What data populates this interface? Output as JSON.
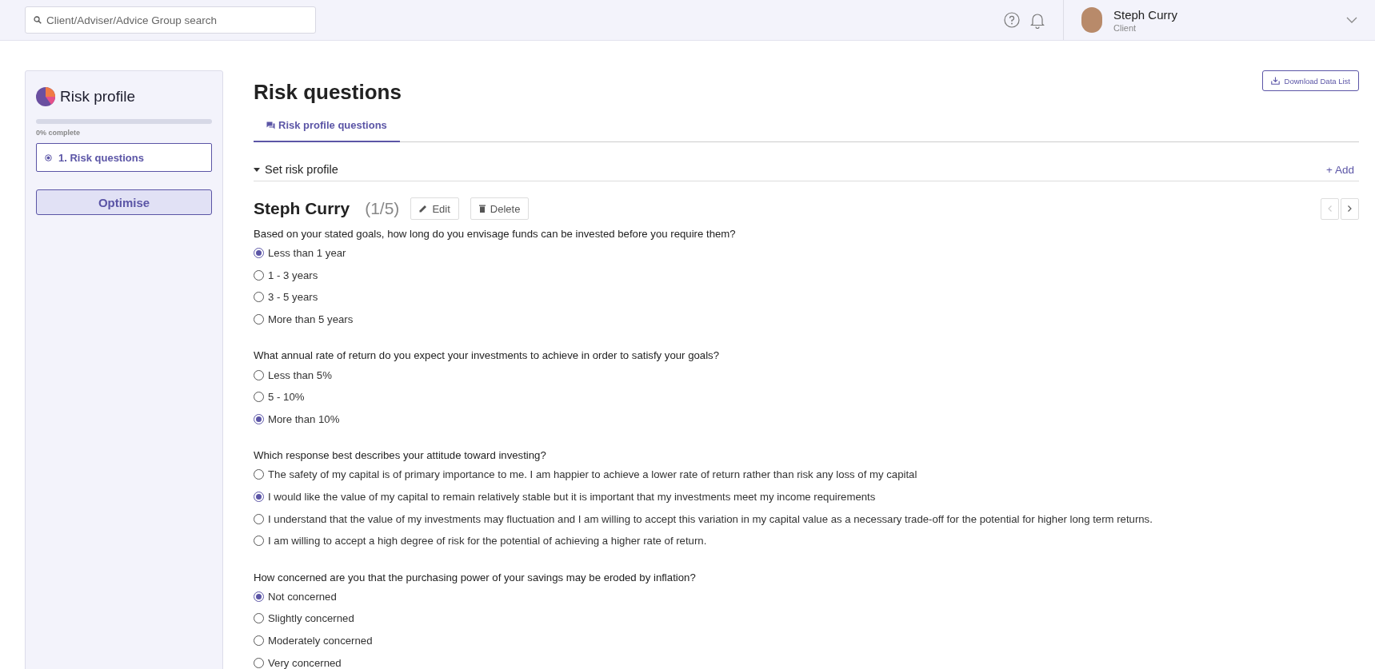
{
  "header": {
    "search": {
      "placeholder": "Client/Adviser/Advice Group search"
    },
    "user": {
      "name": "Steph Curry",
      "role": "Client"
    }
  },
  "sidebar": {
    "title": "Risk profile",
    "progress": {
      "level": 0,
      "label": "0% complete"
    },
    "steps": [
      {
        "label": "1. Risk questions",
        "selected": true
      }
    ],
    "optimise_button": "Optimise"
  },
  "main": {
    "title": "Risk questions",
    "download_button": "Download Data List",
    "tabs": [
      {
        "label": "Risk profile questions",
        "selected": true
      }
    ],
    "section": {
      "title": "Set risk profile",
      "expanded": true,
      "add_link": "+ Add"
    },
    "record": {
      "name": "Steph Curry",
      "counter": "(1/5)",
      "edit_button": "Edit",
      "delete_button": "Delete",
      "prev_disabled": true,
      "next_disabled": false
    },
    "questions": [
      {
        "text": "Based on your stated goals, how long do you envisage funds can be invested before you require them?",
        "options": [
          {
            "label": "Less than 1 year",
            "selected": true
          },
          {
            "label": "1 - 3 years",
            "selected": false
          },
          {
            "label": "3 - 5 years",
            "selected": false
          },
          {
            "label": "More than 5 years",
            "selected": false
          }
        ]
      },
      {
        "text": "What annual rate of return do you expect your investments to achieve in order to satisfy your goals?",
        "options": [
          {
            "label": "Less than 5%",
            "selected": false
          },
          {
            "label": "5 - 10%",
            "selected": false
          },
          {
            "label": "More than 10%",
            "selected": true
          }
        ]
      },
      {
        "text": "Which response best describes your attitude toward investing?",
        "options": [
          {
            "label": "The safety of my capital is of primary importance to me. I am happier to achieve a lower rate of return rather than risk any loss of my capital",
            "selected": false
          },
          {
            "label": "I would like the value of my capital to remain relatively stable but it is important that my investments meet my income requirements",
            "selected": true
          },
          {
            "label": "I understand that the value of my investments may fluctuation and I am willing to accept this variation in my capital value as a necessary trade-off for the potential for higher long term returns.",
            "selected": false
          },
          {
            "label": "I am willing to accept a high degree of risk for the potential of achieving a higher rate of return.",
            "selected": false
          }
        ]
      },
      {
        "text": "How concerned are you that the purchasing power of your savings may be eroded by inflation?",
        "options": [
          {
            "label": "Not concerned",
            "selected": true
          },
          {
            "label": "Slightly concerned",
            "selected": false
          },
          {
            "label": "Moderately concerned",
            "selected": false
          },
          {
            "label": "Very concerned",
            "selected": false
          }
        ]
      }
    ]
  }
}
